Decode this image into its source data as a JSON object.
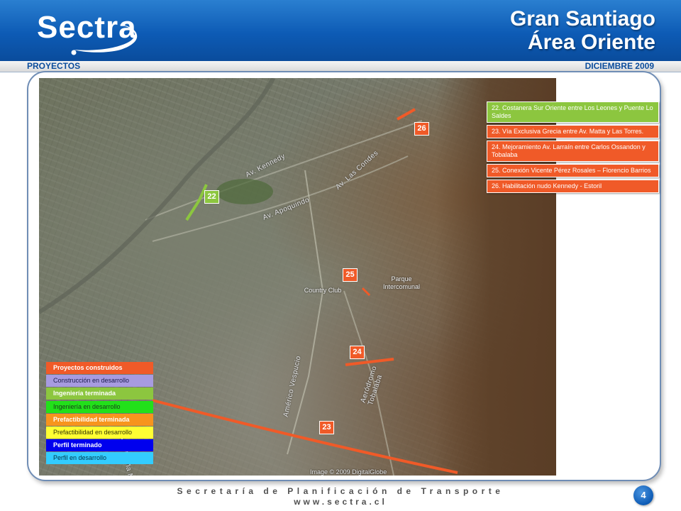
{
  "header": {
    "logo": "Sectra",
    "title_line1": "Gran Santiago",
    "title_line2": "Área Oriente"
  },
  "subbar": {
    "left": "PROYECTOS",
    "right": "DICIEMBRE 2009"
  },
  "map": {
    "streets": {
      "kennedy": "Av. Kennedy",
      "las_condes": "Av. Las Condes",
      "apoquindo": "Av. Apoquindo",
      "vespucio": "Américo Vespucio",
      "aerodromo": "Aeródromo Tobalaba",
      "vicuna": "Av. Vicuña Mackenna"
    },
    "places": {
      "country_club": "Country Club",
      "parque": "Parque Intercomunal"
    },
    "markers": {
      "m22": "22",
      "m23": "23",
      "m24": "24",
      "m25": "25",
      "m26": "26"
    },
    "credit": "Image © 2009 DigitalGlobe"
  },
  "legend": [
    {
      "label": "Proyectos construidos",
      "color": "#f05a28",
      "text": "#ffffff",
      "bold": true
    },
    {
      "label": "Construcción en desarrollo",
      "color": "#a79be0",
      "text": "#1a1a4a",
      "bold": false
    },
    {
      "label": "Ingeniería terminada",
      "color": "#8cc63f",
      "text": "#ffffff",
      "bold": true
    },
    {
      "label": "Ingeniería en desarrollo",
      "color": "#22e01a",
      "text": "#1a3a1a",
      "bold": false
    },
    {
      "label": "Prefactibilidad terminada",
      "color": "#f7941d",
      "text": "#ffffff",
      "bold": true
    },
    {
      "label": "Prefactibilidad en desarrollo",
      "color": "#ffff33",
      "text": "#333300",
      "bold": false
    },
    {
      "label": "Perfil terminado",
      "color": "#0000ee",
      "text": "#ffffff",
      "bold": true
    },
    {
      "label": "Perfil en desarrollo",
      "color": "#33ccff",
      "text": "#003344",
      "bold": false
    }
  ],
  "callouts": [
    {
      "text": "22. Costanera Sur Oriente entre Los Leones y Puente Lo Saldes",
      "color": "#8cc63f"
    },
    {
      "text": "23. Vía Exclusiva Grecia entre Av. Matta y Las Torres.",
      "color": "#f05a28"
    },
    {
      "text": "24. Mejoramiento Av. Larraín entre Carlos Ossandon y Tobalaba",
      "color": "#f05a28"
    },
    {
      "text": "25. Conexión Vicente Pérez Rosales – Florencio Barrios",
      "color": "#f05a28"
    },
    {
      "text": "26. Habilitación nudo Kennedy - Estoril",
      "color": "#f05a28"
    }
  ],
  "colors": {
    "green_project": "#8cc63f",
    "red_project": "#f05a28"
  },
  "footer": {
    "line1": "Secretaría de Planificación de Transporte",
    "line2": "www.sectra.cl",
    "page": "4"
  }
}
